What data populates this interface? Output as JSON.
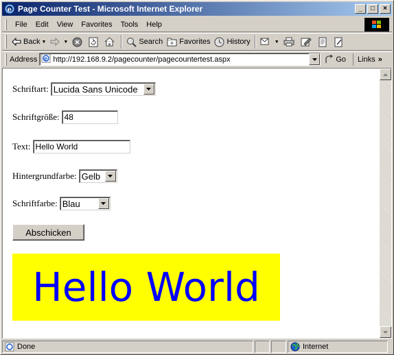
{
  "window": {
    "title": "Page Counter Test - Microsoft Internet Explorer",
    "minimize_glyph": "_",
    "maximize_glyph": "□",
    "close_glyph": "×"
  },
  "menu": {
    "items": [
      {
        "label": "File"
      },
      {
        "label": "Edit"
      },
      {
        "label": "View"
      },
      {
        "label": "Favorites"
      },
      {
        "label": "Tools"
      },
      {
        "label": "Help"
      }
    ]
  },
  "toolbar": {
    "back_label": "Back",
    "search_label": "Search",
    "favorites_label": "Favorites",
    "history_label": "History"
  },
  "address": {
    "label": "Address",
    "url": "http://192.168.9.2/pagecounter/pagecountertest.aspx",
    "go_label": "Go",
    "links_label": "Links"
  },
  "form": {
    "font_label": "Schriftart:",
    "font_value": "Lucida Sans Unicode",
    "size_label": "Schriftgröße:",
    "size_value": "48",
    "text_label": "Text:",
    "text_value": "Hello World",
    "bg_label": "Hintergrundfarbe:",
    "bg_value": "Gelb",
    "color_label": "Schriftfarbe:",
    "color_value": "Blau",
    "submit_label": "Abschicken"
  },
  "preview": {
    "text": "Hello World",
    "background": "#ffff00",
    "color": "#0000ff"
  },
  "status": {
    "text": "Done",
    "zone": "Internet"
  },
  "colors": {
    "titlebar_start": "#0a246a",
    "titlebar_end": "#a6caf0",
    "chrome": "#d4d0c8"
  }
}
